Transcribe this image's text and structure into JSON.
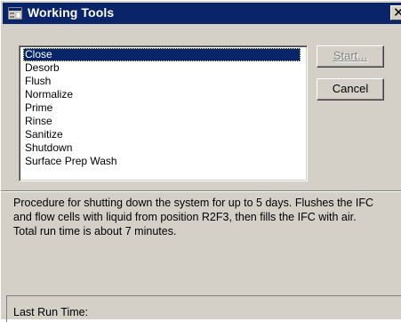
{
  "window": {
    "title": "Working Tools",
    "close_glyph": "✕",
    "icon": "app-window-icon"
  },
  "procedures": {
    "selected_index": 0,
    "items": [
      "Close",
      "Desorb",
      "Flush",
      "Normalize",
      "Prime",
      "Rinse",
      "Sanitize",
      "Shutdown",
      "Surface Prep Wash"
    ]
  },
  "buttons": {
    "start_label": "Start...",
    "start_enabled": false,
    "cancel_label": "Cancel"
  },
  "description": "Procedure for shutting down the system for up to 5 days. Flushes the IFC\nand flow cells with liquid from position R2F3, then fills the IFC with air.\nTotal run time is about 7 minutes.",
  "status": {
    "last_run_label": "Last Run Time:"
  },
  "colors": {
    "titlebar": "#0a246a",
    "face": "#d4d0c8",
    "selection": "#0a246a"
  }
}
